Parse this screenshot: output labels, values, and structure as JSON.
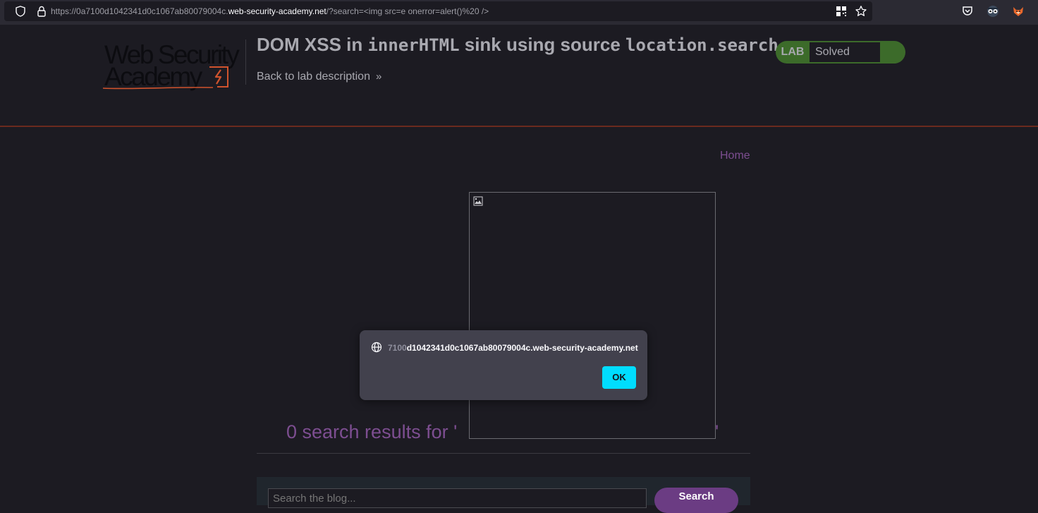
{
  "browser": {
    "url_prefix": "https://0a7100d1042341d0c1067ab80079004c.",
    "url_domain": "web-security-academy.net",
    "url_suffix": "/?search=<img src=e onerror=alert()%20 />"
  },
  "header": {
    "logo_line1": "Web Security",
    "logo_line2": "Academy",
    "title_part1": "DOM XSS in ",
    "title_code1": "innerHTML",
    "title_part2": " sink using source ",
    "title_code2": "location.search",
    "back_link": "Back to lab description",
    "back_chevron": "»",
    "lab_badge": "LAB",
    "lab_state": "Solved",
    "colors": {
      "solved_green": "#3c6b2a",
      "accent_purple": "#7d4e91",
      "rule_orange": "#6b2a1e"
    }
  },
  "nav": {
    "home": "Home"
  },
  "results": {
    "prefix": "0 search results for '",
    "suffix": "'"
  },
  "search": {
    "placeholder": "Search the blog...",
    "button": "Search"
  },
  "alert": {
    "origin_faded": "7100",
    "origin_main": "d1042341d0c1067ab80079004c.web-security-academy.net",
    "ok": "OK",
    "accent": "#00ddff"
  },
  "icons": {
    "url_shield": "shield-icon",
    "url_lock": "lock-icon",
    "qr": "qr-code-icon",
    "star": "bookmark-star-icon",
    "pocket": "pocket-icon",
    "ext1": "extension-icon",
    "ext2": "extension-fox-icon",
    "globe": "globe-icon",
    "broken_image": "broken-image-icon"
  }
}
